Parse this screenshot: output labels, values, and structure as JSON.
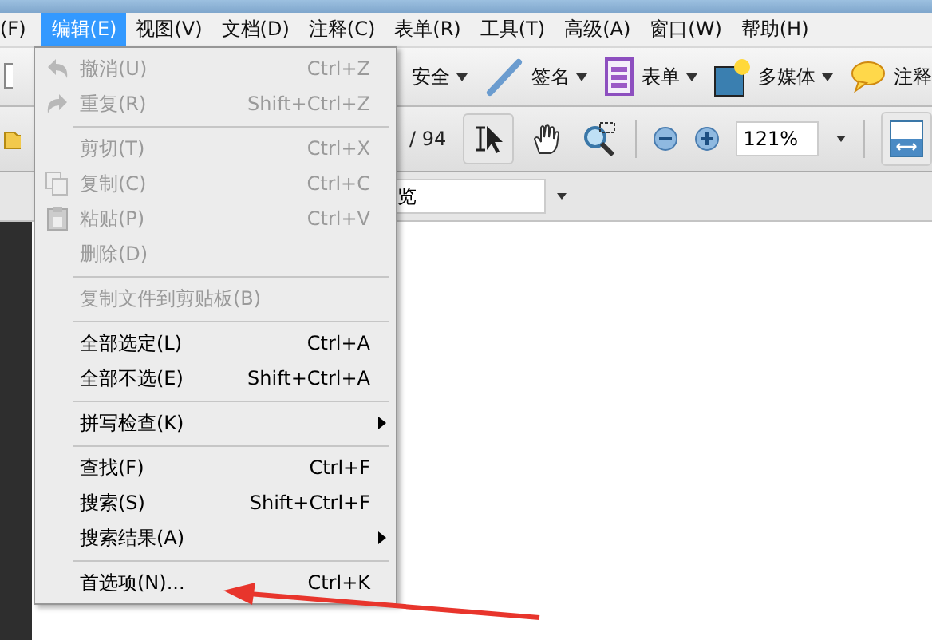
{
  "menubar": [
    {
      "label": "(F)",
      "selected": false
    },
    {
      "label": "编辑(E)",
      "selected": true
    },
    {
      "label": "视图(V)",
      "selected": false
    },
    {
      "label": "文档(D)",
      "selected": false
    },
    {
      "label": "注释(C)",
      "selected": false
    },
    {
      "label": "表单(R)",
      "selected": false
    },
    {
      "label": "工具(T)",
      "selected": false
    },
    {
      "label": "高级(A)",
      "selected": false
    },
    {
      "label": "窗口(W)",
      "selected": false
    },
    {
      "label": "帮助(H)",
      "selected": false
    }
  ],
  "toolbar": [
    {
      "kind": "security",
      "label": "安全"
    },
    {
      "kind": "pen",
      "label": "签名"
    },
    {
      "kind": "form",
      "label": "表单"
    },
    {
      "kind": "media",
      "label": "多媒体"
    },
    {
      "kind": "comment",
      "label": "注释"
    }
  ],
  "nav_toolbar": {
    "page_total": "/ 94",
    "zoom": "121%",
    "select_tool_selected": true
  },
  "find_field": {
    "value": "览"
  },
  "edit_menu": [
    {
      "kind": "undo",
      "label": "撤消(U)",
      "shortcut": "Ctrl+Z",
      "disabled": true,
      "submenu": false
    },
    {
      "kind": "redo",
      "label": "重复(R)",
      "shortcut": "Shift+Ctrl+Z",
      "disabled": true,
      "submenu": false
    },
    {
      "kind": "separator"
    },
    {
      "kind": "item",
      "label": "剪切(T)",
      "shortcut": "Ctrl+X",
      "disabled": true,
      "submenu": false
    },
    {
      "kind": "copy",
      "label": "复制(C)",
      "shortcut": "Ctrl+C",
      "disabled": true,
      "submenu": false
    },
    {
      "kind": "paste",
      "label": "粘贴(P)",
      "shortcut": "Ctrl+V",
      "disabled": true,
      "submenu": false
    },
    {
      "kind": "item",
      "label": "删除(D)",
      "disabled": true,
      "submenu": false
    },
    {
      "kind": "separator"
    },
    {
      "kind": "item",
      "label": "复制文件到剪贴板(B)",
      "disabled": true,
      "submenu": false
    },
    {
      "kind": "separator"
    },
    {
      "kind": "item",
      "label": "全部选定(L)",
      "shortcut": "Ctrl+A",
      "disabled": false,
      "submenu": false
    },
    {
      "kind": "item",
      "label": "全部不选(E)",
      "shortcut": "Shift+Ctrl+A",
      "disabled": false,
      "submenu": false
    },
    {
      "kind": "separator"
    },
    {
      "kind": "item",
      "label": "拼写检查(K)",
      "disabled": false,
      "submenu": true
    },
    {
      "kind": "separator"
    },
    {
      "kind": "item",
      "label": "查找(F)",
      "shortcut": "Ctrl+F",
      "disabled": false,
      "submenu": false
    },
    {
      "kind": "item",
      "label": "搜索(S)",
      "shortcut": "Shift+Ctrl+F",
      "disabled": false,
      "submenu": false
    },
    {
      "kind": "item",
      "label": "搜索结果(A)",
      "disabled": false,
      "submenu": true
    },
    {
      "kind": "separator"
    },
    {
      "kind": "item",
      "label": "首选项(N)...",
      "shortcut": "Ctrl+K",
      "disabled": false,
      "submenu": false
    }
  ]
}
